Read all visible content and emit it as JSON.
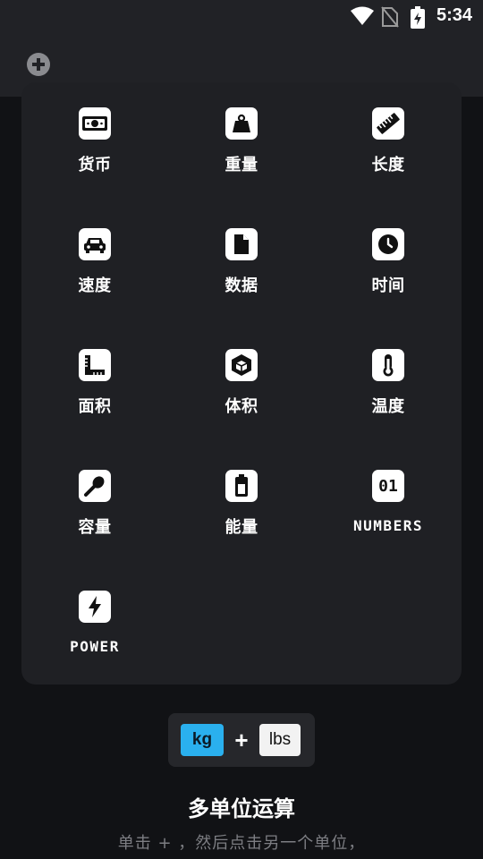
{
  "status_bar": {
    "time": "5:34",
    "icons": [
      "wifi-icon",
      "no-sim-icon",
      "battery-charging-icon"
    ]
  },
  "header": {
    "add_icon": "plus-circle-icon"
  },
  "categories": [
    {
      "label": "货币",
      "icon": "banknote-icon"
    },
    {
      "label": "重量",
      "icon": "weight-icon"
    },
    {
      "label": "长度",
      "icon": "ruler-icon"
    },
    {
      "label": "速度",
      "icon": "car-icon"
    },
    {
      "label": "数据",
      "icon": "file-icon"
    },
    {
      "label": "时间",
      "icon": "clock-icon"
    },
    {
      "label": "面积",
      "icon": "area-ruler-icon"
    },
    {
      "label": "体积",
      "icon": "cube-icon"
    },
    {
      "label": "温度",
      "icon": "thermometer-icon"
    },
    {
      "label": "容量",
      "icon": "spoon-icon"
    },
    {
      "label": "能量",
      "icon": "battery-icon"
    },
    {
      "label": "NUMBERS",
      "icon": "binary-01-icon",
      "icon_text": "01"
    },
    {
      "label": "POWER",
      "icon": "lightning-icon"
    }
  ],
  "feature": {
    "example_unit_a": "kg",
    "example_plus": "+",
    "example_unit_b": "lbs",
    "title": "多单位运算",
    "description": "单击 + ，然后点击另一个单位，"
  },
  "colors": {
    "background": "#111215",
    "panel": "#1f2024",
    "topbar": "#212226",
    "accent": "#2ab0ee",
    "muted_text": "#7d7e83"
  }
}
